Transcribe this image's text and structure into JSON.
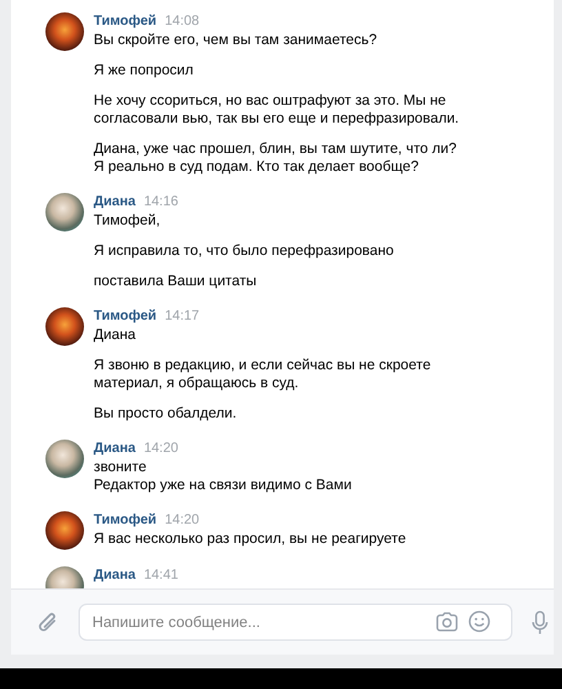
{
  "messages": [
    {
      "author": "Тимофей",
      "time": "14:08",
      "kind": "sunset",
      "paragraphs": [
        [
          "Вы скройте его, чем вы там занимаетесь?"
        ],
        [
          "Я же попросил"
        ],
        [
          "Не хочу ссориться, но вас оштрафуют за это. Мы не согласовали вью, так вы его еще и перефразировали."
        ],
        [
          "Диана, уже час прошел, блин, вы там шутите, что ли? Я реально в суд подам. Кто так делает вообще?"
        ]
      ]
    },
    {
      "author": "Диана",
      "time": "14:16",
      "kind": "illustration",
      "paragraphs": [
        [
          "Тимофей,"
        ],
        [
          "Я исправила то, что было перефразировано"
        ],
        [
          "поставила Ваши цитаты"
        ]
      ]
    },
    {
      "author": "Тимофей",
      "time": "14:17",
      "kind": "sunset",
      "paragraphs": [
        [
          "Диана"
        ],
        [
          "Я звоню в редакцию, и если сейчас вы не скроете материал, я обращаюсь в суд."
        ],
        [
          "Вы просто обалдели."
        ]
      ]
    },
    {
      "author": "Диана",
      "time": "14:20",
      "kind": "illustration",
      "paragraphs": [
        [
          "звоните",
          "Редактор уже на связи видимо с Вами"
        ]
      ]
    },
    {
      "author": "Тимофей",
      "time": "14:20",
      "kind": "sunset",
      "paragraphs": [
        [
          "Я вас несколько раз просил, вы не реагируете"
        ]
      ]
    },
    {
      "author": "Диана",
      "time": "14:41",
      "kind": "illustration"
    }
  ],
  "composer": {
    "placeholder": "Напишите сообщение..."
  }
}
